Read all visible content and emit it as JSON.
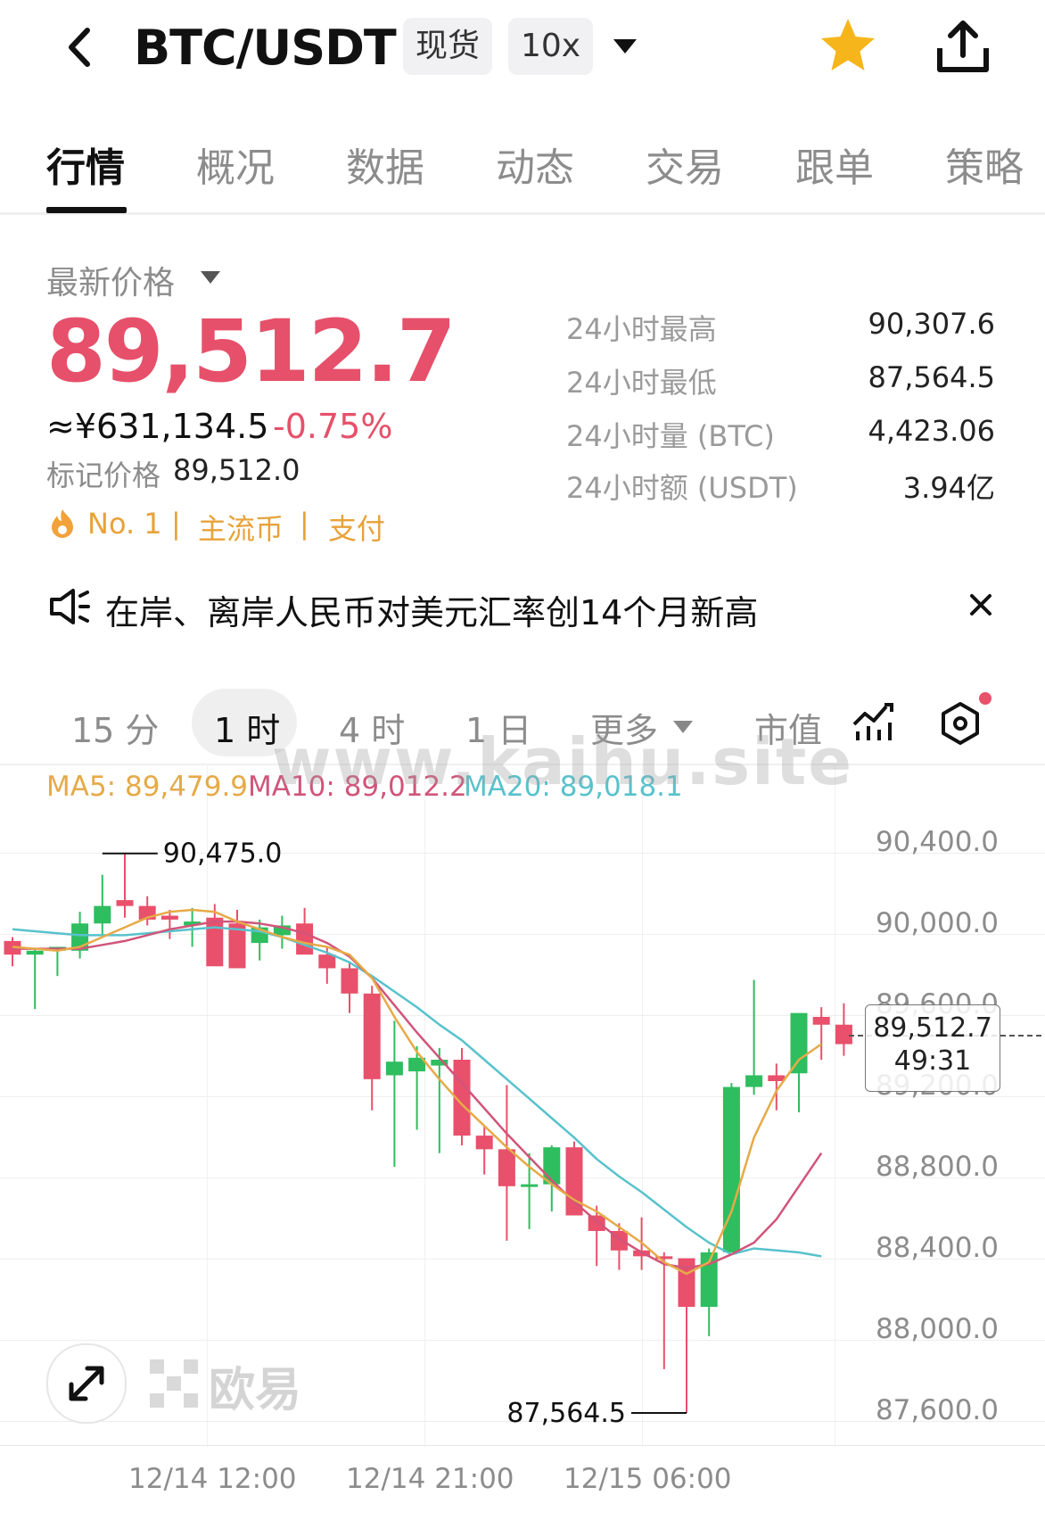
{
  "header": {
    "title": "BTC/USDT",
    "chip_spot": "现货",
    "chip_leverage": "10x"
  },
  "tabs": [
    "行情",
    "概况",
    "数据",
    "动态",
    "交易",
    "跟单",
    "策略"
  ],
  "price": {
    "label": "最新价格",
    "last": "89,512.7",
    "cny": "≈¥631,134.5",
    "change": "-0.75%",
    "mark_label": "标记价格",
    "mark_value": "89,512.0"
  },
  "stats": [
    {
      "label": "24小时最高",
      "value": "90,307.6"
    },
    {
      "label": "24小时最低",
      "value": "87,564.5"
    },
    {
      "label": "24小时量 (BTC)",
      "value": "4,423.06"
    },
    {
      "label": "24小时额 (USDT)",
      "value": "3.94亿"
    }
  ],
  "tags": {
    "rank": "No. 1",
    "sep": "|",
    "t1": "主流币",
    "t2": "支付"
  },
  "announcement": "在岸、离岸人民币对美元汇率创14个月新高",
  "timeframes": {
    "t15m": "15 分",
    "t1h": "1 时",
    "t4h": "4 时",
    "t1d": "1 日",
    "more": "更多",
    "mcap": "市值"
  },
  "ma": {
    "ma5": "MA5: 89,479.9",
    "ma10": "MA10: 89,012.2",
    "ma20": "MA20: 89,018.1"
  },
  "watermark": "www.kaihu.site",
  "logo": "欧易",
  "chart_data": {
    "type": "candlestick",
    "y_ticks": [
      "90,400.0",
      "90,000.0",
      "89,600.0",
      "89,200.0",
      "88,800.0",
      "88,400.0",
      "88,000.0",
      "87,600.0"
    ],
    "x_ticks": [
      "12/14 12:00",
      "12/14 21:00",
      "12/15 06:00"
    ],
    "annotation_high": "90,475.0",
    "annotation_low": "87,564.5",
    "last_price_tag": "89,512.7",
    "countdown": "49:31",
    "ylim": [
      87400,
      90700
    ],
    "candles": [
      [
        89990,
        90010,
        89860,
        89920
      ],
      [
        89920,
        89950,
        89640,
        89940
      ],
      [
        89940,
        89950,
        89810,
        89960
      ],
      [
        89940,
        90140,
        89900,
        90080
      ],
      [
        90080,
        90330,
        90010,
        90170
      ],
      [
        90200,
        90440,
        90110,
        90170
      ],
      [
        90170,
        90220,
        90070,
        90100
      ],
      [
        90120,
        90150,
        90000,
        90100
      ],
      [
        90070,
        90160,
        89960,
        90090
      ],
      [
        90110,
        90180,
        90000,
        89860
      ],
      [
        90080,
        90150,
        89980,
        89850
      ],
      [
        89980,
        90100,
        89890,
        90060
      ],
      [
        90020,
        90120,
        89950,
        90070
      ],
      [
        90080,
        90160,
        89980,
        89920
      ],
      [
        89920,
        89960,
        89770,
        89850
      ],
      [
        89850,
        89880,
        89620,
        89720
      ],
      [
        89720,
        89760,
        89120,
        89280
      ],
      [
        89300,
        89580,
        88830,
        89370
      ],
      [
        89320,
        89450,
        89020,
        89390
      ],
      [
        89350,
        89440,
        88900,
        89380
      ],
      [
        89380,
        89440,
        88940,
        88990
      ],
      [
        88990,
        89040,
        88790,
        88920
      ],
      [
        88920,
        89250,
        88450,
        88730
      ],
      [
        88730,
        88900,
        88510,
        88740
      ],
      [
        88740,
        88940,
        88600,
        88930
      ],
      [
        88930,
        88960,
        88720,
        88580
      ],
      [
        88580,
        88630,
        88320,
        88500
      ],
      [
        88500,
        88540,
        88300,
        88400
      ],
      [
        88400,
        88570,
        88300,
        88370
      ],
      [
        88370,
        88390,
        87790,
        88360
      ],
      [
        88360,
        88350,
        87565,
        88110
      ],
      [
        88110,
        88410,
        87960,
        88390
      ],
      [
        88390,
        89260,
        88390,
        89240
      ],
      [
        89240,
        89790,
        89200,
        89300
      ],
      [
        89300,
        89360,
        89120,
        89270
      ],
      [
        89310,
        89570,
        89110,
        89620
      ],
      [
        89600,
        89650,
        89380,
        89560
      ],
      [
        89560,
        89670,
        89400,
        89460
      ]
    ],
    "ma5": [
      89960,
      89950,
      89940,
      89960,
      90010,
      90060,
      90110,
      90140,
      90150,
      90140,
      90090,
      90050,
      90010,
      89980,
      89960,
      89920,
      89800,
      89600,
      89420,
      89280,
      89150,
      89040,
      88930,
      88830,
      88740,
      88660,
      88600,
      88520,
      88440,
      88340,
      88280,
      88340,
      88600,
      88980,
      89220,
      89380,
      89460
    ],
    "ma10": [
      89950,
      89950,
      89950,
      89950,
      89970,
      89990,
      90020,
      90050,
      90070,
      90090,
      90090,
      90080,
      90060,
      90030,
      89980,
      89910,
      89800,
      89660,
      89520,
      89390,
      89260,
      89130,
      89000,
      88880,
      88760,
      88650,
      88550,
      88460,
      88390,
      88330,
      88310,
      88330,
      88380,
      88440,
      88560,
      88730,
      88900
    ],
    "ma20": [
      90050,
      90040,
      90030,
      90020,
      90020,
      90020,
      90030,
      90040,
      90050,
      90060,
      90050,
      90040,
      90010,
      89970,
      89930,
      89880,
      89810,
      89730,
      89650,
      89560,
      89480,
      89380,
      89280,
      89180,
      89080,
      88980,
      88870,
      88780,
      88700,
      88610,
      88520,
      88440,
      88380,
      88410,
      88400,
      88390,
      88370
    ]
  },
  "colors": {
    "down": "#e8506b",
    "up": "#2ebd5f",
    "ma5": "#e6aa47",
    "ma10": "#d1557a",
    "ma20": "#58c2cc",
    "tag": "#e8a23a",
    "price": "#e6506a",
    "star": "#f6b51b"
  },
  "icons": [
    "back-icon",
    "dropdown-icon",
    "star-icon",
    "share-icon",
    "speaker-icon",
    "close-icon",
    "indicator-icon",
    "settings-icon",
    "expand-icon",
    "okx-logo-icon"
  ]
}
